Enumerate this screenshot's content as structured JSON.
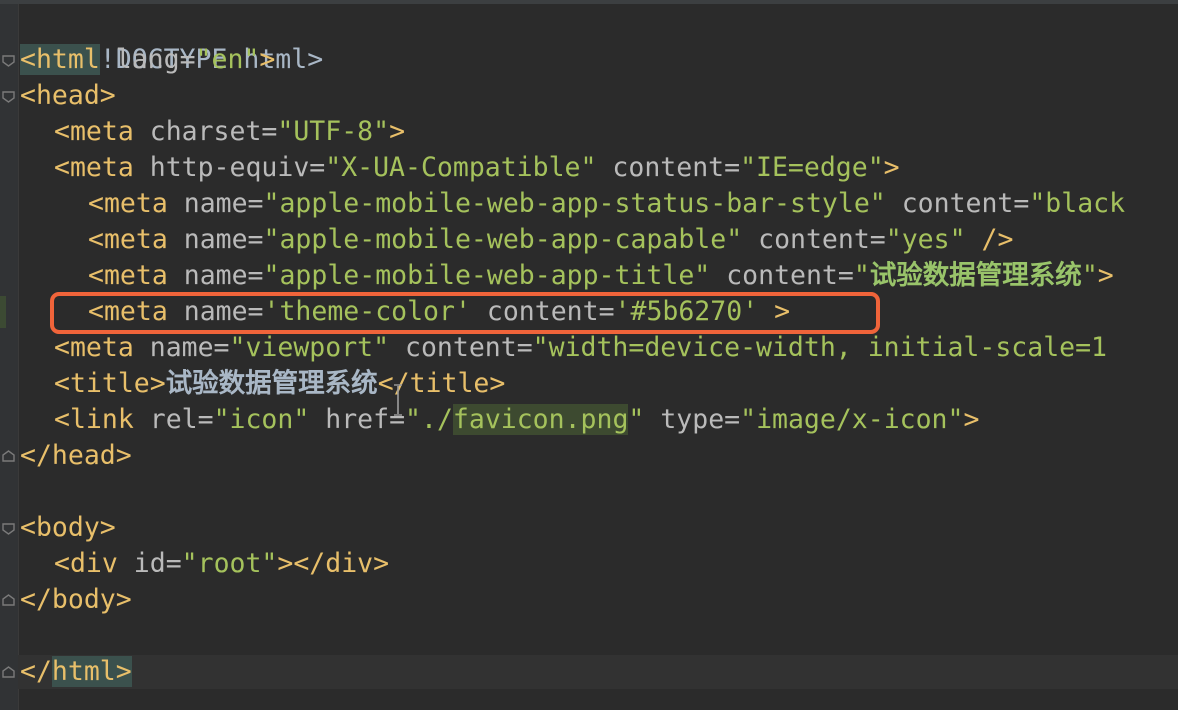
{
  "editor": {
    "lines": [
      {
        "id": "doctype",
        "parts": [
          "<!DOCTYPE html>"
        ]
      },
      {
        "id": "html-open",
        "parts": [
          "<",
          "html",
          " lang=",
          "\"en\"",
          ">"
        ]
      },
      {
        "id": "head-open",
        "parts": [
          "<head>"
        ]
      },
      {
        "id": "meta-charset",
        "parts": [
          "<meta",
          " charset=",
          "\"UTF-8\"",
          ">"
        ]
      },
      {
        "id": "meta-compat",
        "parts": [
          "<meta",
          " http-equiv=",
          "\"X-UA-Compatible\"",
          " content=",
          "\"IE=edge\"",
          ">"
        ]
      },
      {
        "id": "meta-statusbar",
        "parts": [
          "<meta",
          " name=",
          "\"apple-mobile-web-app-status-bar-style\"",
          " content=",
          "\"black"
        ]
      },
      {
        "id": "meta-capable",
        "parts": [
          "<meta",
          " name=",
          "\"apple-mobile-web-app-capable\"",
          " content=",
          "\"yes\"",
          " />"
        ]
      },
      {
        "id": "meta-apptitle",
        "parts": [
          "<meta",
          " name=",
          "\"apple-mobile-web-app-title\"",
          " content=",
          "\"",
          "试验数据管理系统",
          "\"",
          ">"
        ]
      },
      {
        "id": "meta-theme",
        "parts": [
          "<meta",
          " name=",
          "'theme-color'",
          " content=",
          "'#5b6270'",
          " >"
        ]
      },
      {
        "id": "meta-viewport",
        "parts": [
          "<meta",
          " name=",
          "\"viewport\"",
          " content=",
          "\"width=device-width, initial-scale=1"
        ]
      },
      {
        "id": "title",
        "parts": [
          "<title>",
          "试验数据管理系统",
          "</title>"
        ]
      },
      {
        "id": "link-icon",
        "parts": [
          "<link",
          " rel=",
          "\"icon\"",
          " href=",
          "\"./",
          "favicon.png",
          "\"",
          " type=",
          "\"image/x-icon\"",
          ">"
        ]
      },
      {
        "id": "head-close",
        "parts": [
          "</head>"
        ]
      },
      {
        "id": "body-open",
        "parts": [
          "<body>"
        ]
      },
      {
        "id": "div-root",
        "parts": [
          "<div",
          " id=",
          "\"root\"",
          "></div>"
        ]
      },
      {
        "id": "body-close",
        "parts": [
          "</body>"
        ]
      },
      {
        "id": "html-close",
        "parts": [
          "</",
          "html",
          ">"
        ]
      }
    ]
  },
  "colors": {
    "background": "#2b2b2b",
    "tag": "#e8bf6a",
    "attribute": "#bababa",
    "string": "#a5c25c",
    "highlight_box": "#f0643a"
  },
  "icons": {
    "fold": "fold-marker-icon",
    "cursor": "text-cursor-icon"
  }
}
